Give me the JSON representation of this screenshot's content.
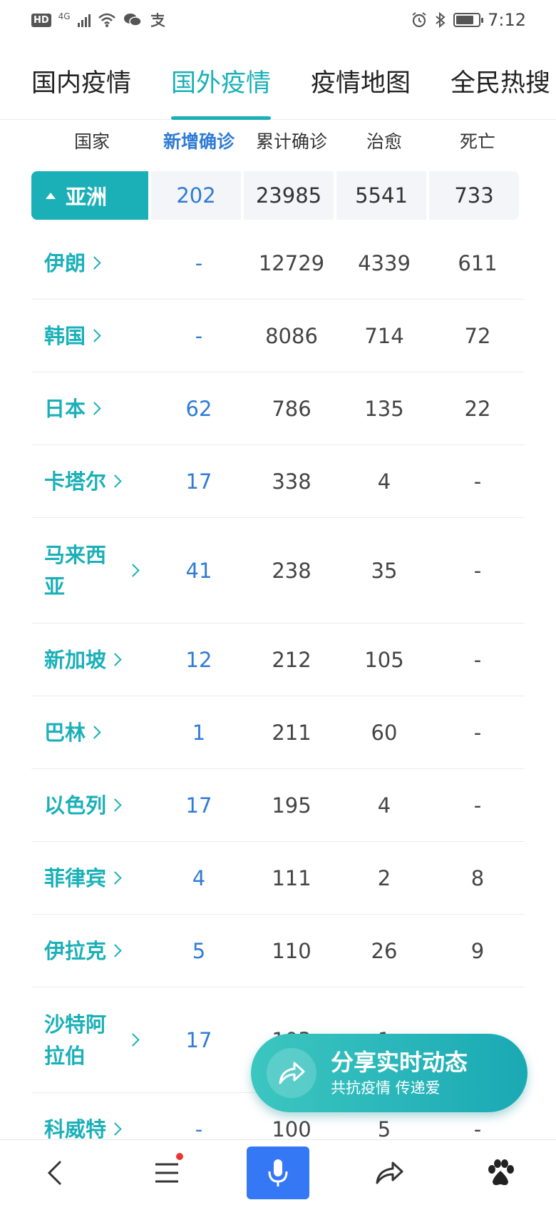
{
  "status_bar": {
    "hd": "HD",
    "network": "4G",
    "time": "7:12",
    "battery_level": 0.8,
    "icons": [
      "hd-icon",
      "signal-icon",
      "wifi-icon",
      "wechat-icon",
      "alipay-icon",
      "alarm-icon",
      "bluetooth-icon",
      "battery-icon"
    ]
  },
  "tabs": [
    {
      "label": "国内疫情",
      "active": false
    },
    {
      "label": "国外疫情",
      "active": true
    },
    {
      "label": "疫情地图",
      "active": false
    },
    {
      "label": "全民热搜",
      "active": false
    }
  ],
  "table": {
    "headers": [
      "国家",
      "新增确诊",
      "累计确诊",
      "治愈",
      "死亡"
    ],
    "continent": {
      "name": "亚洲",
      "new": "202",
      "total": "23985",
      "cured": "5541",
      "deaths": "733"
    },
    "rows": [
      {
        "country": "伊朗",
        "new": "-",
        "total": "12729",
        "cured": "4339",
        "deaths": "611"
      },
      {
        "country": "韩国",
        "new": "-",
        "total": "8086",
        "cured": "714",
        "deaths": "72"
      },
      {
        "country": "日本",
        "new": "62",
        "total": "786",
        "cured": "135",
        "deaths": "22"
      },
      {
        "country": "卡塔尔",
        "new": "17",
        "total": "338",
        "cured": "4",
        "deaths": "-"
      },
      {
        "country": "马来西亚",
        "new": "41",
        "total": "238",
        "cured": "35",
        "deaths": "-"
      },
      {
        "country": "新加坡",
        "new": "12",
        "total": "212",
        "cured": "105",
        "deaths": "-"
      },
      {
        "country": "巴林",
        "new": "1",
        "total": "211",
        "cured": "60",
        "deaths": "-"
      },
      {
        "country": "以色列",
        "new": "17",
        "total": "195",
        "cured": "4",
        "deaths": "-"
      },
      {
        "country": "菲律宾",
        "new": "4",
        "total": "111",
        "cured": "2",
        "deaths": "8"
      },
      {
        "country": "伊拉克",
        "new": "5",
        "total": "110",
        "cured": "26",
        "deaths": "9"
      },
      {
        "country": "沙特阿拉伯",
        "new": "17",
        "total": "103",
        "cured": "1",
        "deaths": "-"
      },
      {
        "country": "科威特",
        "new": "-",
        "total": "100",
        "cured": "5",
        "deaths": "-"
      }
    ]
  },
  "share": {
    "title": "分享实时动态",
    "subtitle": "共抗疫情 传递爱"
  },
  "bottom_nav": {
    "items": [
      "back-icon",
      "menu-icon",
      "mic-icon",
      "share-icon",
      "baidu-paw-icon"
    ]
  },
  "colors": {
    "accent": "#1bb0b8",
    "blue": "#2f7bd6",
    "mic": "#3478f6"
  }
}
